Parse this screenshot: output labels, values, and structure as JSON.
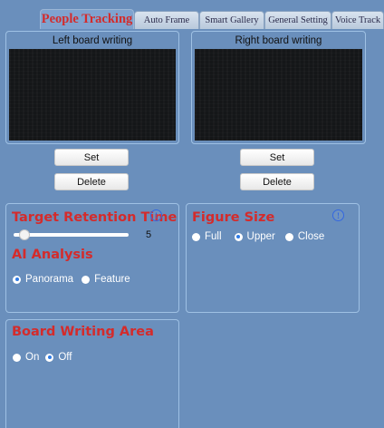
{
  "tabs": [
    {
      "label": "People Tracking",
      "active": true
    },
    {
      "label": "Auto Frame",
      "active": false
    },
    {
      "label": "Smart Gallery",
      "active": false
    },
    {
      "label": "General Setting",
      "active": false
    },
    {
      "label": "Voice Track",
      "active": false
    }
  ],
  "left_board": {
    "title": "Left board writing",
    "set_label": "Set",
    "delete_label": "Delete"
  },
  "right_board": {
    "title": "Right board writing",
    "set_label": "Set",
    "delete_label": "Delete"
  },
  "target_retention": {
    "title": "Target Retention Time",
    "info_glyph": "!",
    "slider_value": "5",
    "slider_fraction": 0.05
  },
  "ai_analysis": {
    "title": "AI Analysis",
    "options": [
      "Panorama",
      "Feature"
    ],
    "selected": "Panorama"
  },
  "figure_size": {
    "title": "Figure Size",
    "info_glyph": "!",
    "options": [
      "Full",
      "Upper",
      "Close"
    ],
    "selected": "Upper"
  },
  "board_writing_area": {
    "title": "Board Writing Area",
    "options": [
      "On",
      "Off"
    ],
    "selected": "Off"
  },
  "colors": {
    "background": "#6a8fbc",
    "accent_red": "#d42b2b",
    "radio_selected": "#2f7be5",
    "info_blue": "#3367e0"
  }
}
